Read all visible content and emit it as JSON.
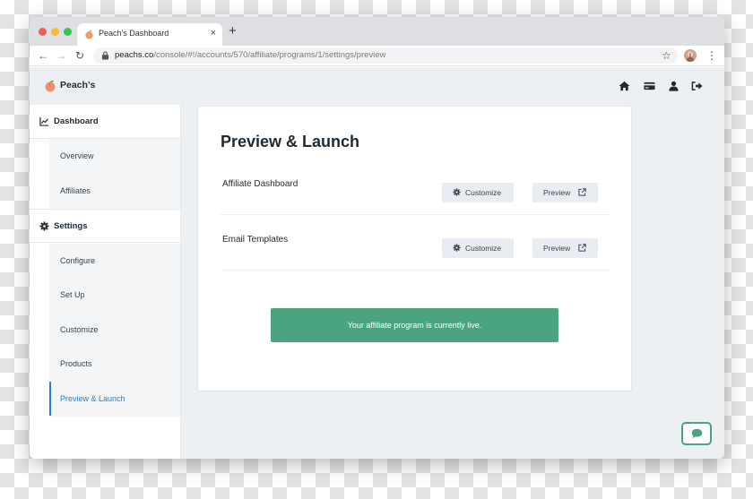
{
  "browser": {
    "tab_title": "Peach's Dashboard",
    "tab_close": "×",
    "new_tab": "+",
    "url_host": "peachs.co",
    "url_path": "/console/#!/accounts/570/affiliate/programs/1/settings/preview",
    "nav": {
      "back": "←",
      "forward": "→",
      "reload": "↻",
      "bookmark": "☆",
      "menu": "⋮"
    }
  },
  "app": {
    "brand": "Peach’s",
    "header_icons": [
      "home-icon",
      "credit-card-icon",
      "user-icon",
      "sign-out-icon"
    ]
  },
  "sidebar": {
    "dashboard_label": "Dashboard",
    "dashboard_items": [
      {
        "label": "Overview"
      },
      {
        "label": "Affiliates"
      }
    ],
    "settings_label": "Settings",
    "settings_items": [
      {
        "label": "Configure"
      },
      {
        "label": "Set Up"
      },
      {
        "label": "Customize"
      },
      {
        "label": "Products"
      },
      {
        "label": "Preview & Launch",
        "active": true
      }
    ]
  },
  "main": {
    "title": "Preview & Launch",
    "rows": [
      {
        "label": "Affiliate Dashboard",
        "customize_label": "Customize",
        "preview_label": "Preview"
      },
      {
        "label": "Email Templates",
        "customize_label": "Customize",
        "preview_label": "Preview"
      }
    ],
    "status_banner": "Your affiliate program is currently live."
  },
  "colors": {
    "accent_green": "#4aa47f",
    "active_blue": "#2c7ed6",
    "text_dark": "#1f2a33"
  }
}
